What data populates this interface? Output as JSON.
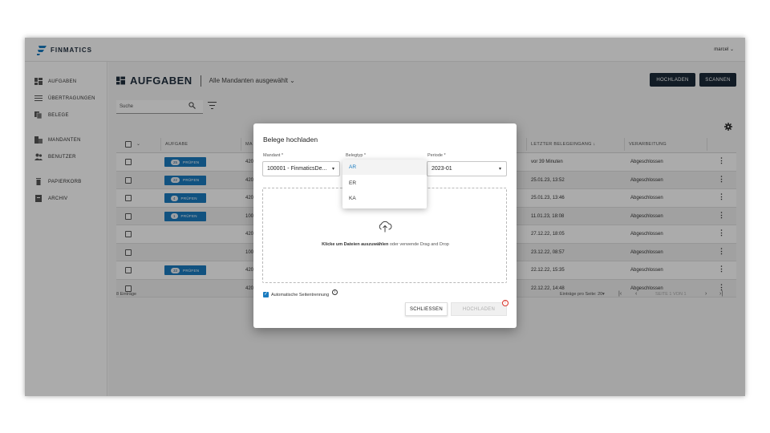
{
  "app": {
    "logo_text": "FINMATICS",
    "user": "marcel ⌄",
    "brand_color": "#1a7bbf",
    "dark_color": "#1c2b3a"
  },
  "sidebar": {
    "items": [
      {
        "label": "AUFGABEN",
        "icon": "dashboard-icon"
      },
      {
        "label": "ÜBERTRAGUNGEN",
        "icon": "list-icon"
      },
      {
        "label": "BELEGE",
        "icon": "documents-icon"
      },
      {
        "label": "MANDANTEN",
        "icon": "building-icon"
      },
      {
        "label": "BENUTZER",
        "icon": "users-icon"
      },
      {
        "label": "PAPIERKORB",
        "icon": "trash-icon"
      },
      {
        "label": "ARCHIV",
        "icon": "archive-icon"
      }
    ]
  },
  "header": {
    "title": "AUFGABEN",
    "subtitle": "Alle Mandanten ausgewählt ⌄",
    "upload_label": "HOCHLADEN",
    "scan_label": "SCANNEN"
  },
  "search": {
    "placeholder": "Suche"
  },
  "table": {
    "columns": {
      "task": "AUFGABE",
      "mandant": "MA",
      "last": "LETZTER BELEGEINGANG ↓",
      "processing": "VERARBEITUNG"
    },
    "pruefen_label": "PRÜFEN",
    "rows": [
      {
        "count": "25",
        "mandant": "420",
        "last": "vor 39 Minuten",
        "status": "Abgeschlossen"
      },
      {
        "count": "22",
        "mandant": "420",
        "last": "25.01.23, 13:52",
        "status": "Abgeschlossen"
      },
      {
        "count": "4",
        "mandant": "420",
        "last": "25.01.23, 13:46",
        "status": "Abgeschlossen"
      },
      {
        "count": "1",
        "mandant": "100",
        "last": "11.01.23, 18:08",
        "status": "Abgeschlossen"
      },
      {
        "count": "",
        "mandant": "420",
        "last": "27.12.22, 18:05",
        "status": "Abgeschlossen"
      },
      {
        "count": "",
        "mandant": "100",
        "last": "23.12.22, 08:57",
        "status": "Abgeschlossen"
      },
      {
        "count": "33",
        "mandant": "420",
        "last": "22.12.22, 15:35",
        "status": "Abgeschlossen"
      },
      {
        "count": "",
        "mandant": "420",
        "last": "22.12.22, 14:48",
        "status": "Abgeschlossen"
      }
    ],
    "footer": {
      "entries": "8 Einträge",
      "per_page": "Einträge pro Seite: 20",
      "page": "SEITE 1 VON 1"
    }
  },
  "modal": {
    "title": "Belege hochladen",
    "mandant_label": "Mandant *",
    "mandant_value": "100001 - FinmaticsDe...",
    "belegtyp_label": "Belegtyp *",
    "periode_label": "Periode *",
    "periode_value": "2023-01",
    "belegtyp_options": [
      "AR",
      "ER",
      "KA"
    ],
    "dropzone_bold": "Klicke um Dateien auszuwählen",
    "dropzone_rest": " oder verwende Drag and Drop",
    "auto_split_label": "Automatische Seitentrennung",
    "close_label": "SCHLIESSEN",
    "upload_label": "HOCHLADEN"
  }
}
